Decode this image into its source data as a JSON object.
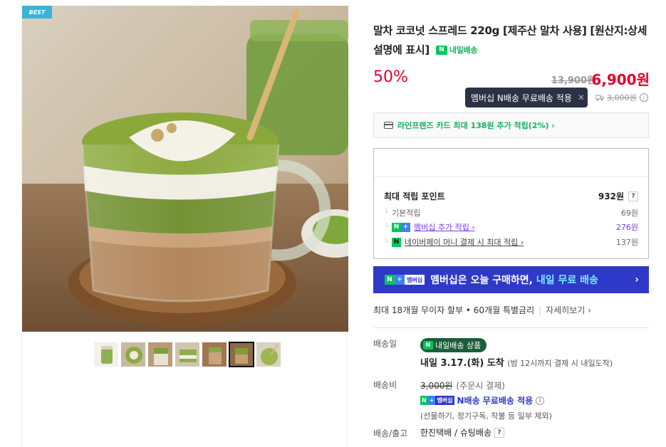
{
  "badge": "BEST",
  "product": {
    "title": "말차 코코넛 스프레드 220g [제주산 말차 사용] [원산지:상세설명에 표시]",
    "delivery_tag": "내일배송",
    "discount": "50%",
    "original_price": "13,900원",
    "sale_price": "6,900원"
  },
  "tooltip": {
    "text": "멤버십 N배송 무료배송 적용",
    "close": "✕"
  },
  "shipping_fee_top": "3,000원",
  "card_benefit": "라인프렌즈 카드 최대 138원 추가 적립(2%) ›",
  "points": {
    "header": "최대 적립 포인트",
    "total": "932원",
    "help": "?",
    "rows": [
      {
        "label": "기본적립",
        "value": "69원"
      },
      {
        "label": "멤버십 추가 적립 ›",
        "value": "276원"
      },
      {
        "label": "네이버페이 머니 결제 시 최대 적립 ›",
        "value": "137원"
      }
    ]
  },
  "member_banner": {
    "badge_text": "멤버십",
    "text": "멤버십은 오늘 구매하면,",
    "highlight": "내일 무료 배송",
    "arrow": "›"
  },
  "installment": {
    "text": "최대 18개월 무이자 할부 • 60개월 특별금리",
    "more": "자세히보기 ›"
  },
  "delivery": {
    "label": "배송일",
    "pill": "내일배송 상품",
    "arrive": "내일 3.17.(화) 도착",
    "arrive_sub": "(밤 12시까지 결제 시 내일도착)"
  },
  "fee": {
    "label": "배송비",
    "strike": "3,000원",
    "cond": "(주문시 결제)",
    "badge_text": "멤버십",
    "free": "N배송 무료배송 적용",
    "exclude": "(선물하기, 정기구독, 착불 등 일부 제외)"
  },
  "courier": {
    "label": "배송/출고",
    "value": "한진택배 / 슈팅배송",
    "help": "?"
  },
  "thumbnails": [
    "jar",
    "latte-top",
    "latte-side",
    "latte-glass",
    "latte-wood",
    "latte-main",
    "latte-spoon"
  ],
  "colors": {
    "accent_red": "#e4002b",
    "naver_green": "#03c75a",
    "member_blue": "#2f39c8",
    "purple": "#7a3ed9"
  }
}
